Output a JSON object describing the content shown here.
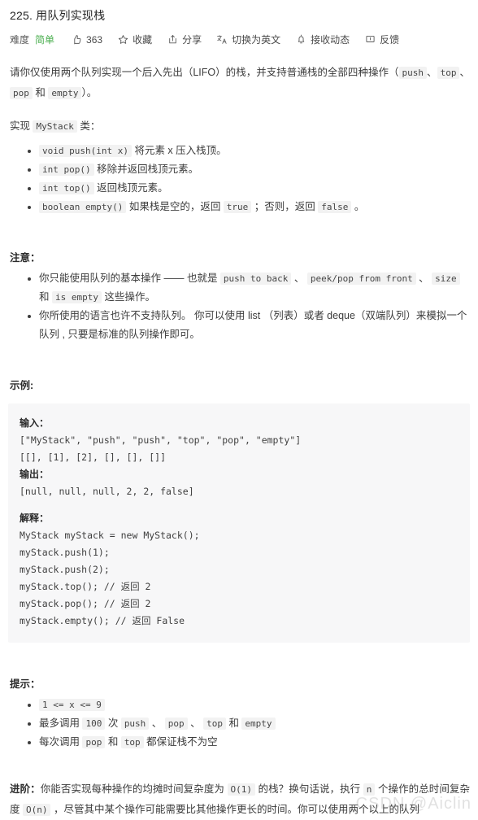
{
  "header": {
    "title": "225. 用队列实现栈",
    "meta": {
      "difficulty_label": "难度",
      "difficulty_value": "简单",
      "difficulty_color": "#4caf50",
      "likes": "363",
      "favorite": "收藏",
      "share": "分享",
      "translate": "切换为英文",
      "subscribe": "接收动态",
      "feedback": "反馈"
    }
  },
  "intro": {
    "p1_a": "请你仅使用两个队列实现一个后入先出（LIFO）的栈，并支持普通栈的全部四种操作（",
    "p1_code1": "push",
    "p1_b": "、",
    "p1_code2": "top",
    "p1_c": "、",
    "p1_code3": "pop",
    "p1_d": " 和 ",
    "p1_code4": "empty",
    "p1_e": "）。",
    "p2_a": "实现 ",
    "p2_code": "MyStack",
    "p2_b": " 类："
  },
  "methods": [
    {
      "code": "void push(int x)",
      "text": " 将元素 x 压入栈顶。"
    },
    {
      "code": "int pop()",
      "text": " 移除并返回栈顶元素。"
    },
    {
      "code": "int top()",
      "text": " 返回栈顶元素。"
    },
    {
      "code": "boolean empty()",
      "text": " 如果栈是空的，返回 ",
      "code2": "true",
      "text2": " ；否则，返回 ",
      "code3": "false",
      "text3": " 。"
    }
  ],
  "notes": {
    "heading": "注意：",
    "item1_a": "你只能使用队列的基本操作 —— 也就是 ",
    "item1_c1": "push to back",
    "item1_b": " 、 ",
    "item1_c2": "peek/pop from front",
    "item1_c": " 、 ",
    "item1_c3": "size",
    "item1_d": " 和 ",
    "item1_c4": "is empty",
    "item1_e": " 这些操作。",
    "item2": "你所使用的语言也许不支持队列。 你可以使用 list （列表）或者 deque（双端队列）来模拟一个队列 , 只要是标准的队列操作即可。"
  },
  "example": {
    "heading": "示例:",
    "input_label": "输入：",
    "input_line1": "[\"MyStack\", \"push\", \"push\", \"top\", \"pop\", \"empty\"]",
    "input_line2": "[[], [1], [2], [], [], []]",
    "output_label": "输出：",
    "output_line1": "[null, null, null, 2, 2, false]",
    "explain_label": "解释：",
    "explain_lines": [
      "MyStack myStack = new MyStack();",
      "myStack.push(1);",
      "myStack.push(2);",
      "myStack.top(); // 返回 2",
      "myStack.pop(); // 返回 2",
      "myStack.empty(); // 返回 False"
    ]
  },
  "hints": {
    "heading": "提示：",
    "item1_code": "1 <= x <= 9",
    "item2_a": "最多调用 ",
    "item2_c1": "100",
    "item2_b": " 次 ",
    "item2_c2": "push",
    "item2_c": " 、 ",
    "item2_c3": "pop",
    "item2_d": " 、 ",
    "item2_c4": "top",
    "item2_e": " 和 ",
    "item2_c5": "empty",
    "item3_a": "每次调用 ",
    "item3_c1": "pop",
    "item3_b": " 和 ",
    "item3_c2": "top",
    "item3_c": " 都保证栈不为空"
  },
  "advanced": {
    "label": "进阶：",
    "a": "你能否实现每种操作的均摊时间复杂度为 ",
    "code1": "O(1)",
    "b": " 的栈？换句话说，执行 ",
    "code2": "n",
    "c": " 个操作的总时间复杂度 ",
    "code3": "O(n)",
    "d": " ，尽管其中某个操作可能需要比其他操作更长的时间。你可以使用两个以上的队列"
  },
  "watermark": "CSDN @Aiclin"
}
